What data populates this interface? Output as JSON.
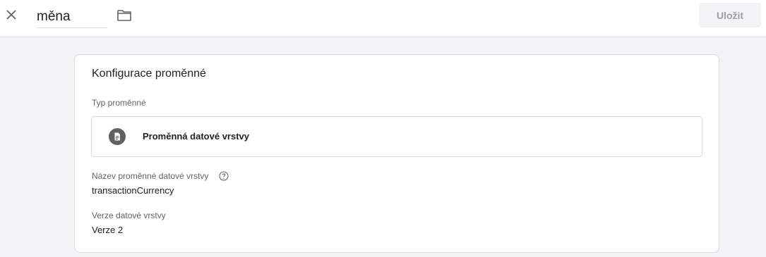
{
  "header": {
    "close_icon": "close-icon",
    "name_value": "měna",
    "folder_icon": "folder-icon",
    "save_label": "Uložit"
  },
  "config": {
    "title": "Konfigurace proměnné",
    "type_label": "Typ proměnné",
    "type_icon": "document-icon",
    "type_name": "Proměnná datové vrstvy",
    "dlv_name_label": "Název proměnné datové vrstvy",
    "help_icon": "help-icon",
    "dlv_name_value": "transactionCurrency",
    "version_label": "Verze datové vrstvy",
    "version_value": "Verze 2"
  },
  "colors": {
    "background": "#f1f3f4",
    "card": "#ffffff",
    "border": "#dadce0",
    "label": "#5f6368",
    "text": "#202124",
    "icon_circle": "#616161",
    "save_disabled_text": "#9aa0a6"
  }
}
